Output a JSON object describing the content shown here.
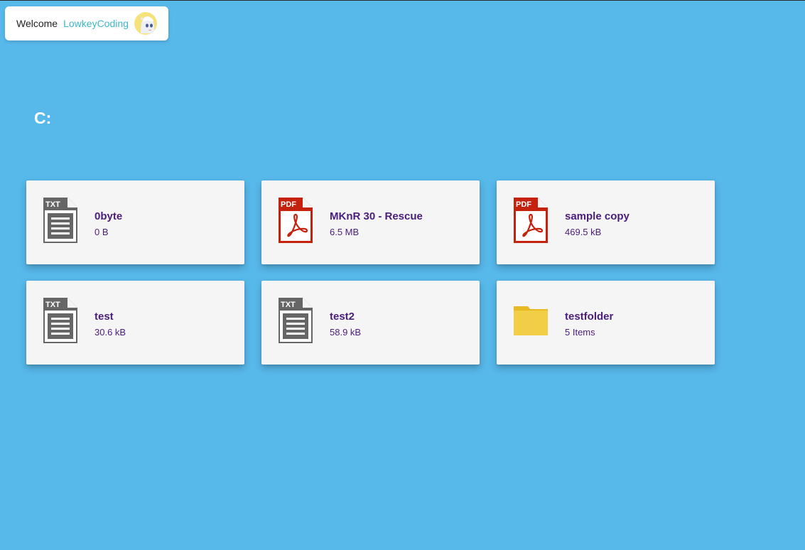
{
  "header": {
    "welcome_label": "Welcome",
    "username": "LowkeyCoding"
  },
  "page": {
    "title": "C:"
  },
  "items": [
    {
      "name": "0byte",
      "size": "0 B",
      "icon": "txt-file-icon",
      "type": "txt"
    },
    {
      "name": "MKnR 30 - Rescue",
      "size": "6.5 MB",
      "icon": "pdf-file-icon",
      "type": "pdf"
    },
    {
      "name": "sample copy",
      "size": "469.5 kB",
      "icon": "pdf-file-icon",
      "type": "pdf"
    },
    {
      "name": "test",
      "size": "30.6 kB",
      "icon": "txt-file-icon",
      "type": "txt"
    },
    {
      "name": "test2",
      "size": "58.9 kB",
      "icon": "txt-file-icon",
      "type": "txt"
    },
    {
      "name": "testfolder",
      "size": "5 Items",
      "icon": "folder-icon",
      "type": "folder"
    }
  ],
  "colors": {
    "background": "#57b8ea",
    "card": "#f5f5f5",
    "text_accent": "#4a1d7a",
    "username": "#3fb6c6",
    "txt_icon": "#666666",
    "pdf_icon": "#c4210f",
    "folder_icon": "#f2cd46"
  }
}
